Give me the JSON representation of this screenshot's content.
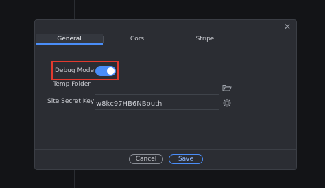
{
  "dialog": {
    "tabs": [
      {
        "label": "General",
        "active": true
      },
      {
        "label": "Cors",
        "active": false
      },
      {
        "label": "Stripe",
        "active": false
      }
    ],
    "fields": {
      "debug_mode_label": "Debug Mode",
      "debug_mode_on": true,
      "temp_folder_label": "Temp Folder",
      "temp_folder_value": "",
      "site_secret_key_label": "Site Secret Key",
      "site_secret_key_value": "w8kc97HB6NBouth"
    },
    "buttons": {
      "cancel_label": "Cancel",
      "save_label": "Save"
    }
  },
  "colors": {
    "accent": "#4a8df8",
    "highlight": "#e23a2e"
  },
  "icons": {
    "close": "close-icon",
    "folder": "folder-open-icon",
    "gear": "gear-icon"
  }
}
